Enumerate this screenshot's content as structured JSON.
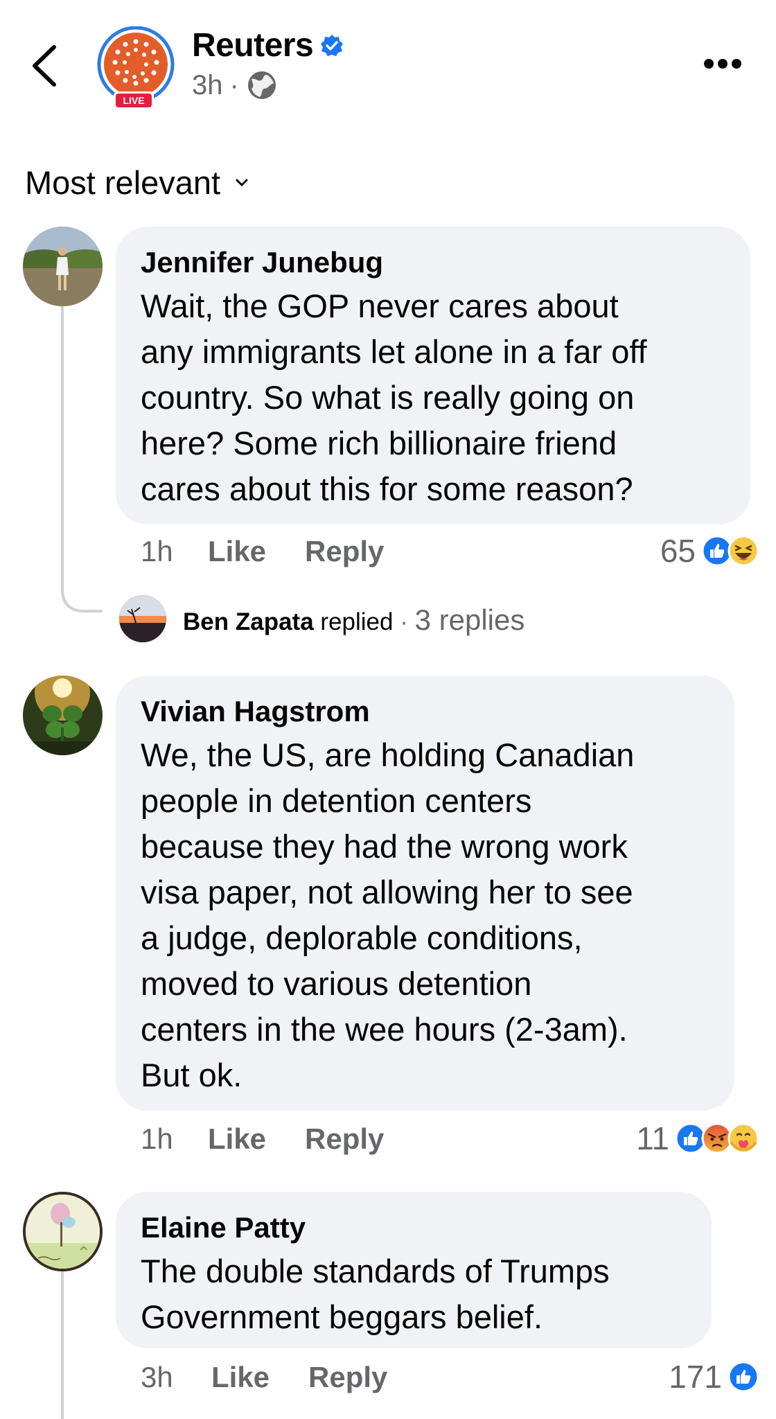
{
  "header": {
    "page_name": "Reuters",
    "time": "3h",
    "separator": "·",
    "live_badge": "LIVE",
    "icons": [
      "back-chevron-icon",
      "verified-badge-icon",
      "globe-icon",
      "more-options-icon"
    ]
  },
  "sort": {
    "label": "Most relevant"
  },
  "comments": [
    {
      "author": "Jennifer Junebug",
      "lines": [
        "Wait, the GOP never cares about",
        "any immigrants let alone in a far off",
        "country. So what is really going on",
        "here? Some rich billionaire friend",
        "cares about this for some reason?"
      ],
      "time": "1h",
      "like": "Like",
      "reply": "Reply",
      "reaction_count": "65",
      "reactions": [
        "like",
        "haha"
      ],
      "replies": {
        "name": "Ben Zapata",
        "action": "replied",
        "separator": "·",
        "count": "3 replies"
      }
    },
    {
      "author": "Vivian Hagstrom",
      "lines": [
        "We, the US, are holding Canadian",
        "people in detention centers",
        "because they had the wrong work",
        "visa paper, not allowing her to see",
        "a judge, deplorable conditions,",
        "moved to various detention",
        "centers in the wee hours (2-3am).",
        "But ok."
      ],
      "time": "1h",
      "like": "Like",
      "reply": "Reply",
      "reaction_count": "11",
      "reactions": [
        "like",
        "angry",
        "care"
      ]
    },
    {
      "author": "Elaine Patty",
      "lines": [
        "The double standards of Trumps",
        "Government beggars belief."
      ],
      "time": "3h",
      "like": "Like",
      "reply": "Reply",
      "reaction_count": "171",
      "reactions": [
        "like"
      ]
    }
  ],
  "colors": {
    "bubble": "#f0f2f5",
    "secondary_text": "#65676b",
    "facebook_blue": "#1877f2",
    "reuters_orange": "#e35d2a",
    "live_red": "#e41e3f"
  }
}
